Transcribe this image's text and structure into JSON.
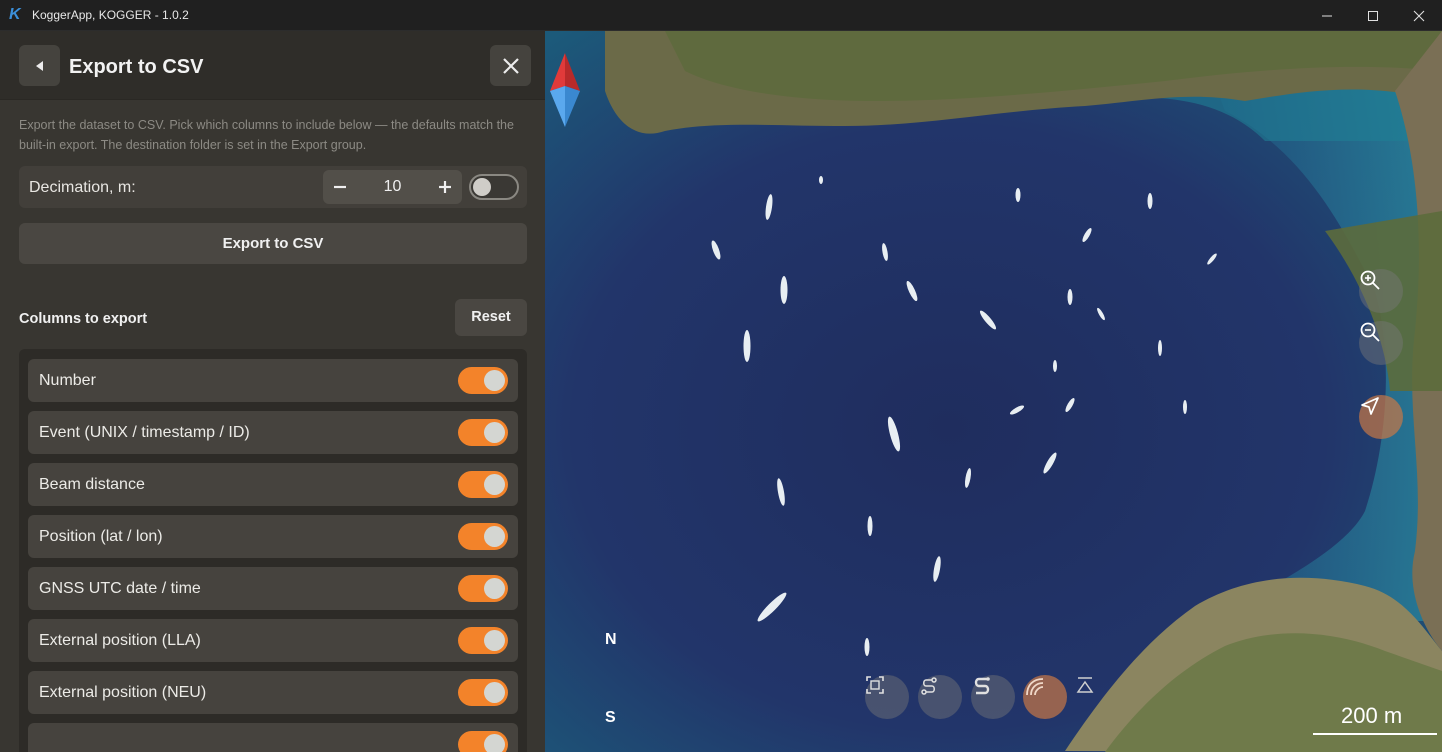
{
  "window": {
    "title": "KoggerApp, KOGGER - 1.0.2",
    "logo_letter": "K",
    "minimize_icon": "minimize-icon",
    "maximize_icon": "maximize-icon",
    "close_icon": "close-icon"
  },
  "panel": {
    "title": "Export to CSV",
    "description": "Export the dataset to CSV. Pick which columns to include below — the defaults match the built-in export. The destination folder is set in the Export group.",
    "decimation": {
      "label": "Decimation, m:",
      "value": "10",
      "enabled": false
    },
    "export_button": "Export to CSV",
    "columns_label": "Columns to export",
    "reset_button": "Reset",
    "columns": [
      {
        "label": "Number",
        "checked": true
      },
      {
        "label": "Event (UNIX / timestamp / ID)",
        "checked": true
      },
      {
        "label": "Beam distance",
        "checked": true
      },
      {
        "label": "Position (lat / lon)",
        "checked": true
      },
      {
        "label": "GNSS UTC date / time",
        "checked": true
      },
      {
        "label": "External position (LLA)",
        "checked": true
      },
      {
        "label": "External position (NEU)",
        "checked": true
      },
      {
        "label": "",
        "checked": true
      }
    ]
  },
  "map": {
    "compass_n": "N",
    "compass_s": "S",
    "scale": "200 m",
    "side_controls": [
      "zoom-in-icon",
      "zoom-out-icon",
      "navigate-icon"
    ],
    "bottom_controls": [
      "fit-view-icon",
      "track-icon",
      "track-alt-icon",
      "signal-icon",
      "triangle-icon"
    ],
    "accent": "#f3832a"
  }
}
